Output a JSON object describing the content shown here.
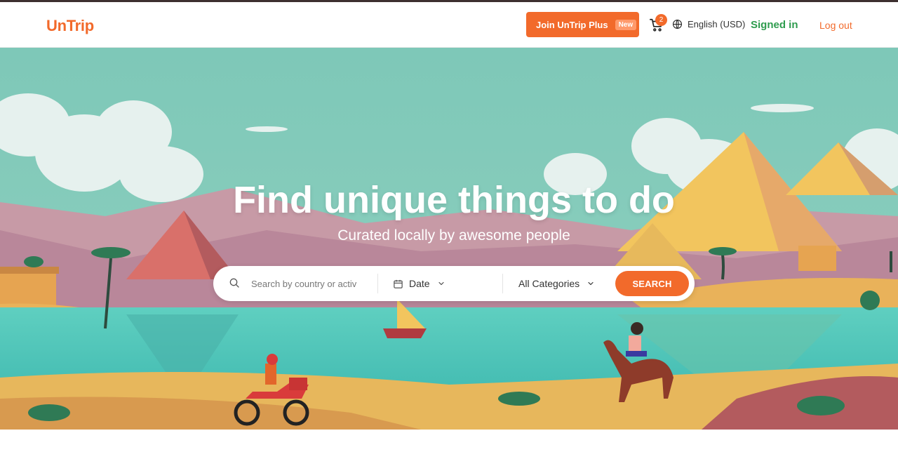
{
  "header": {
    "logo": "UnTrip",
    "join_label": "Join UnTrip Plus",
    "new_badge": "New",
    "cart_count": "2",
    "language": "English (USD)",
    "signed_in": "Signed in",
    "logout": "Log out"
  },
  "hero": {
    "title": "Find unique things to do",
    "subtitle": "Curated locally by awesome people"
  },
  "search": {
    "placeholder": "Search by country or activ",
    "date_label": "Date",
    "category_label": "All Categories",
    "button_label": "SEARCH"
  },
  "colors": {
    "brand": "#f26a2b",
    "signed_in": "#2e9c4e",
    "sky": "#7cc6b6"
  },
  "icons": [
    "cart-icon",
    "globe-icon",
    "search-icon",
    "calendar-icon",
    "chevron-down-icon"
  ]
}
